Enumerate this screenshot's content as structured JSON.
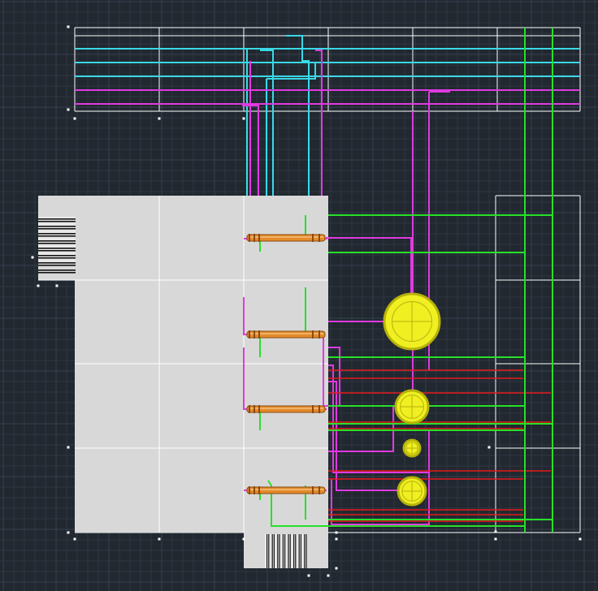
{
  "app": {
    "view": "cad-model-space-viewport",
    "background": "#212830"
  },
  "colors": {
    "grid": "#2e3642",
    "grid_major": "#38414f",
    "frame": "#ffffff",
    "cyan": "#3ad9e8",
    "magenta": "#e03ae0",
    "green": "#28e028",
    "red": "#e41a1a",
    "panel_fill": "#d8d8d8",
    "panel_divider": "#ffffff",
    "rod_fill": "#e38a2a",
    "rod_edge": "#8a4a10",
    "sphere_fill": "#f0ef22",
    "sphere_edge": "#b6b20a",
    "grip": "#ffffff"
  },
  "icons": {
    "roller": "roller-tube-icon",
    "sphere": "sphere-fixture-icon",
    "barcode": "barcode-block-icon"
  },
  "objects": {
    "rollers": 4,
    "spheres": 4,
    "barcode_blocks": 2
  }
}
